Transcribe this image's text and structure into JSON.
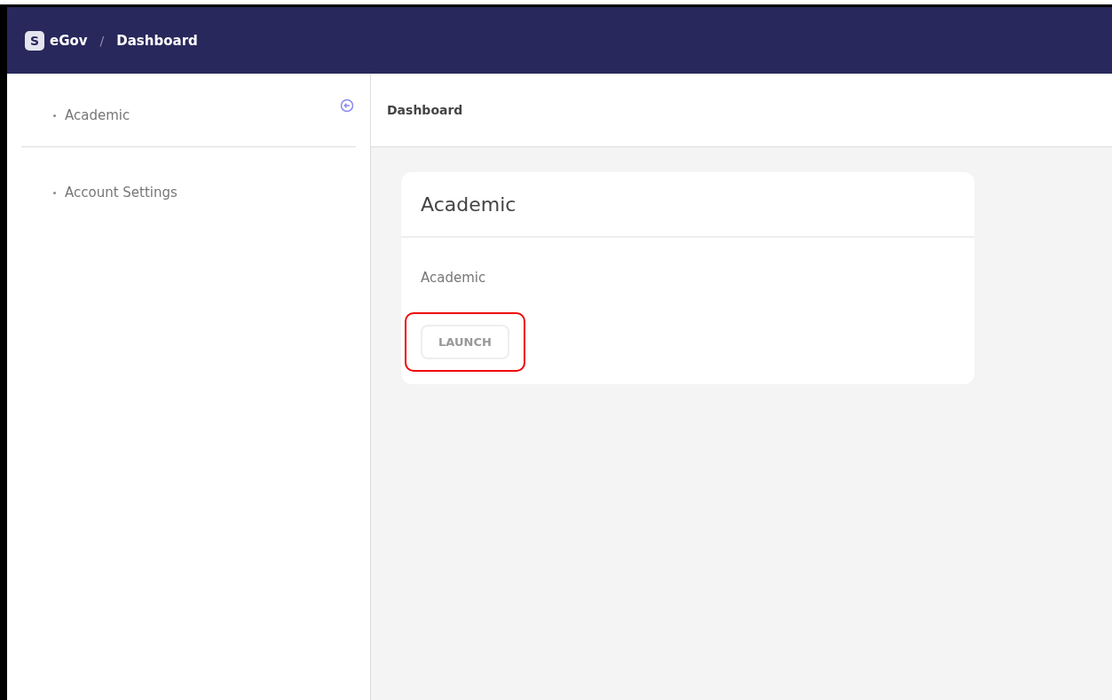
{
  "header": {
    "logo_letter": "S",
    "app_name": "eGov",
    "separator": "/",
    "breadcrumb": "Dashboard"
  },
  "sidebar": {
    "items": [
      {
        "label": "Academic"
      },
      {
        "label": "Account Settings"
      }
    ]
  },
  "page_title": "Dashboard",
  "card": {
    "title": "Academic",
    "description": "Academic",
    "button": "LAUNCH",
    "highlighted": true
  }
}
